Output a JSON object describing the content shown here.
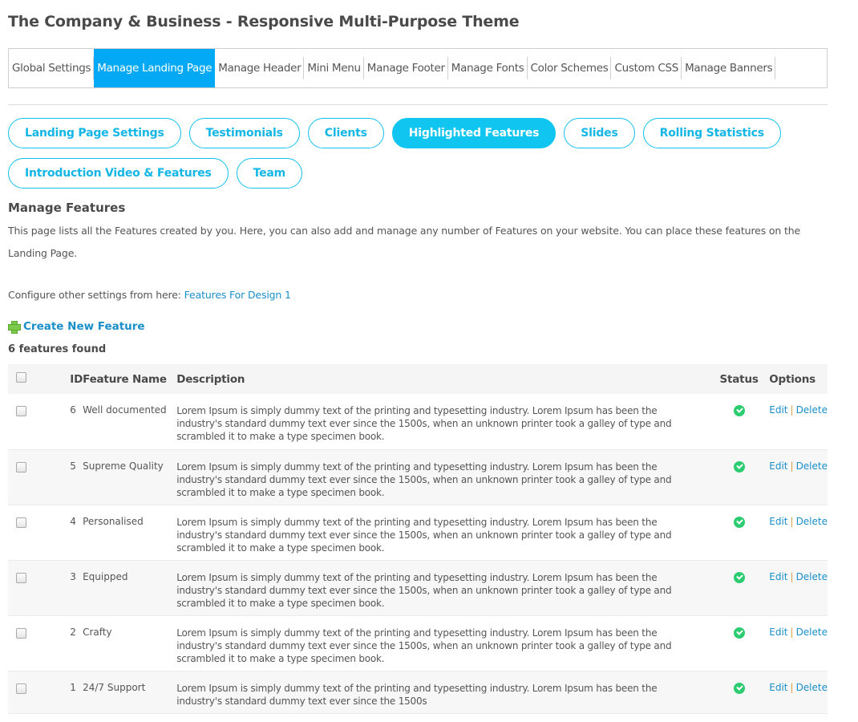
{
  "page": {
    "title": "The Company & Business - Responsive Multi-Purpose Theme"
  },
  "topnav": {
    "items": [
      {
        "label": "Global Settings",
        "active": false
      },
      {
        "label": "Manage Landing Page",
        "active": true
      },
      {
        "label": "Manage Header",
        "active": false
      },
      {
        "label": "Mini Menu",
        "active": false
      },
      {
        "label": "Manage Footer",
        "active": false
      },
      {
        "label": "Manage Fonts",
        "active": false
      },
      {
        "label": "Color Schemes",
        "active": false
      },
      {
        "label": "Custom CSS",
        "active": false
      },
      {
        "label": "Manage Banners",
        "active": false
      }
    ]
  },
  "subtabs": {
    "row1": [
      {
        "label": "Landing Page Settings",
        "active": false
      },
      {
        "label": "Testimonials",
        "active": false
      },
      {
        "label": "Clients",
        "active": false
      },
      {
        "label": "Highlighted Features",
        "active": true
      },
      {
        "label": "Slides",
        "active": false
      },
      {
        "label": "Rolling Statistics",
        "active": false
      }
    ],
    "row2": [
      {
        "label": "Introduction Video & Features",
        "active": false
      },
      {
        "label": "Team",
        "active": false
      }
    ]
  },
  "section": {
    "title": "Manage Features",
    "intro": "This page lists all the Features created by you. Here, you can also add and manage any number of Features on your website. You can place these features on the Landing Page.",
    "configure_prefix": "Configure other settings from here: ",
    "configure_link": "Features For Design 1",
    "create_label": "Create New Feature",
    "count_label": "6 features found"
  },
  "table": {
    "headers": {
      "id": "ID",
      "name": "Feature Name",
      "description": "Description",
      "status": "Status",
      "options": "Options"
    },
    "edit_label": "Edit",
    "delete_label": "Delete",
    "separator": "|",
    "rows": [
      {
        "id": "6",
        "name": "Well documented",
        "description": "Lorem Ipsum is simply dummy text of the printing and typesetting industry. Lorem Ipsum has been the industry's standard dummy text ever since the 1500s, when an unknown printer took a galley of type and scrambled it to make a type specimen book.",
        "status": "enabled"
      },
      {
        "id": "5",
        "name": "Supreme Quality",
        "description": "Lorem Ipsum is simply dummy text of the printing and typesetting industry. Lorem Ipsum has been the industry's standard dummy text ever since the 1500s, when an unknown printer took a galley of type and scrambled it to make a type specimen book.",
        "status": "enabled"
      },
      {
        "id": "4",
        "name": "Personalised",
        "description": "Lorem Ipsum is simply dummy text of the printing and typesetting industry. Lorem Ipsum has been the industry's standard dummy text ever since the 1500s, when an unknown printer took a galley of type and scrambled it to make a type specimen book.",
        "status": "enabled"
      },
      {
        "id": "3",
        "name": "Equipped",
        "description": "Lorem Ipsum is simply dummy text of the printing and typesetting industry. Lorem Ipsum has been the industry's standard dummy text ever since the 1500s, when an unknown printer took a galley of type and scrambled it to make a type specimen book.",
        "status": "enabled"
      },
      {
        "id": "2",
        "name": "Crafty",
        "description": "Lorem Ipsum is simply dummy text of the printing and typesetting industry. Lorem Ipsum has been the industry's standard dummy text ever since the 1500s, when an unknown printer took a galley of type and scrambled it to make a type specimen book.",
        "status": "enabled"
      },
      {
        "id": "1",
        "name": "24/7 Support",
        "description": "Lorem Ipsum is simply dummy text of the printing and typesetting industry. Lorem Ipsum has been the industry's standard dummy text ever since the 1500s",
        "status": "enabled"
      }
    ]
  },
  "colors": {
    "accent": "#03a9f4",
    "pill_accent": "#10c6f0",
    "link": "#1a8fc9",
    "status_ok": "#2ecc71"
  }
}
